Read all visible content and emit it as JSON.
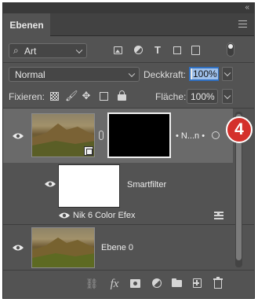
{
  "panel": {
    "collapse_glyph": "«"
  },
  "tabs": [
    {
      "label": "Ebenen"
    }
  ],
  "filter": {
    "search_glyph": "⌕",
    "value": "Art"
  },
  "toolbar_icons": [
    "image-filter-icon",
    "adjustment-filter-icon",
    "type-filter-icon",
    "shape-filter-icon",
    "smart-object-filter-icon",
    "filter-toggle-icon"
  ],
  "blend": {
    "value": "Normal",
    "opacity_label": "Deckkraft:",
    "opacity_value": "100%"
  },
  "lock": {
    "label": "Fixieren:",
    "fill_label": "Fläche:",
    "fill_value": "100%"
  },
  "layers": [
    {
      "name": "• N...n •",
      "type": "smart-object",
      "selected": true
    },
    {
      "name": "Smartfilter",
      "type": "smart-filter-mask"
    },
    {
      "name": "Nik 6 Color Efex",
      "type": "filter"
    },
    {
      "name": "Ebene 0",
      "type": "pixel"
    }
  ],
  "bottom": {
    "fx_label": "fx"
  },
  "badge": {
    "label": "4",
    "color": "#d4302b"
  }
}
